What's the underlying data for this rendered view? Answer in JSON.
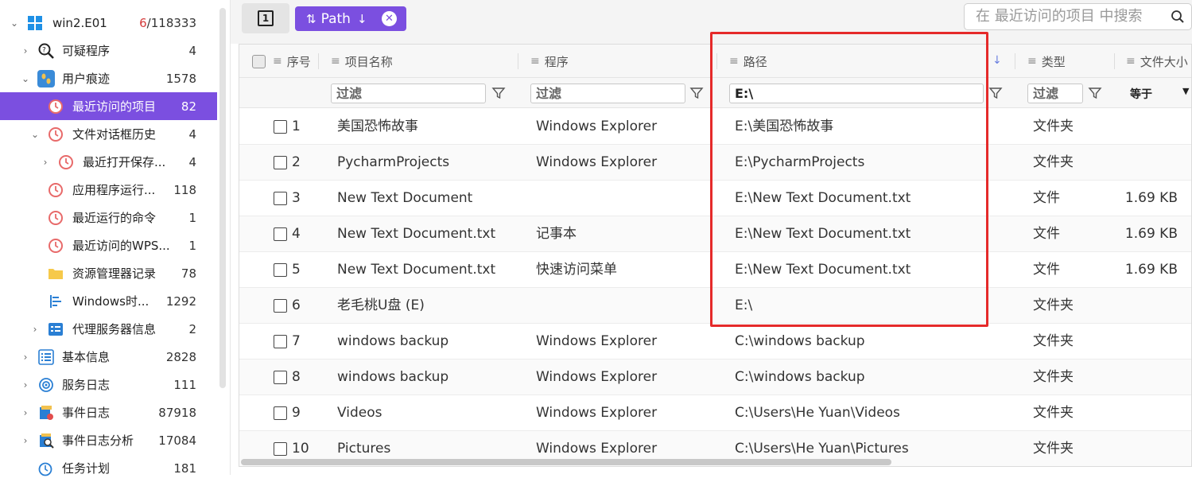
{
  "sidebar": {
    "items": [
      {
        "label": "win2.E01",
        "count_red": "6",
        "count_rest": "/118333",
        "icon": "windows-icon"
      },
      {
        "label": "可疑程序",
        "count": "4",
        "icon": "search-suspect-icon"
      },
      {
        "label": "用户痕迹",
        "count": "1578",
        "icon": "footprints-icon"
      },
      {
        "label": "最近访问的项目",
        "count": "82",
        "icon": "clock-icon"
      },
      {
        "label": "文件对话框历史",
        "count": "4",
        "icon": "clock-icon"
      },
      {
        "label": "最近打开保存...",
        "count": "4",
        "icon": "clock-icon"
      },
      {
        "label": "应用程序运行...",
        "count": "118",
        "icon": "clock-icon"
      },
      {
        "label": "最近运行的命令",
        "count": "1",
        "icon": "clock-icon"
      },
      {
        "label": "最近访问的WPS...",
        "count": "1",
        "icon": "clock-icon"
      },
      {
        "label": "资源管理器记录",
        "count": "78",
        "icon": "folder-icon"
      },
      {
        "label": "Windows时...",
        "count": "1292",
        "icon": "timeline-icon"
      },
      {
        "label": "代理服务器信息",
        "count": "2",
        "icon": "proxy-icon"
      },
      {
        "label": "基本信息",
        "count": "2828",
        "icon": "list-icon"
      },
      {
        "label": "服务日志",
        "count": "111",
        "icon": "service-icon"
      },
      {
        "label": "事件日志",
        "count": "87918",
        "icon": "event-log-icon"
      },
      {
        "label": "事件日志分析",
        "count": "17084",
        "icon": "event-analysis-icon"
      },
      {
        "label": "任务计划",
        "count": "181",
        "icon": "task-icon"
      }
    ]
  },
  "toolbar": {
    "toggle_label": "1",
    "chip_sort_glyph": "⇅",
    "chip_label": "Path",
    "chip_arrow": "↓",
    "chip_close": "✕",
    "search_placeholder": "在 最近访问的项目 中搜索"
  },
  "grid": {
    "columns": [
      "序号",
      "项目名称",
      "程序",
      "路径",
      "类型",
      "文件大小"
    ],
    "filters": {
      "name": "过滤",
      "program": "过滤",
      "path": "E:\\",
      "type": "过滤",
      "size_op": "等于"
    },
    "rows": [
      {
        "no": "1",
        "name": "美国恐怖故事",
        "program": "Windows Explorer",
        "path": "E:\\美国恐怖故事",
        "type": "文件夹",
        "size": ""
      },
      {
        "no": "2",
        "name": "PycharmProjects",
        "program": "Windows Explorer",
        "path": "E:\\PycharmProjects",
        "type": "文件夹",
        "size": ""
      },
      {
        "no": "3",
        "name": "New Text Document",
        "program": "",
        "path": "E:\\New Text Document.txt",
        "type": "文件",
        "size": "1.69 KB"
      },
      {
        "no": "4",
        "name": "New Text Document.txt",
        "program": "记事本",
        "path": "E:\\New Text Document.txt",
        "type": "文件",
        "size": "1.69 KB"
      },
      {
        "no": "5",
        "name": "New Text Document.txt",
        "program": "快速访问菜单",
        "path": "E:\\New Text Document.txt",
        "type": "文件",
        "size": "1.69 KB"
      },
      {
        "no": "6",
        "name": "老毛桃U盘 (E)",
        "program": "",
        "path": "E:\\",
        "type": "文件夹",
        "size": ""
      },
      {
        "no": "7",
        "name": "windows backup",
        "program": "Windows Explorer",
        "path": "C:\\windows backup",
        "type": "文件夹",
        "size": ""
      },
      {
        "no": "8",
        "name": "windows backup",
        "program": "Windows Explorer",
        "path": "C:\\windows backup",
        "type": "文件夹",
        "size": ""
      },
      {
        "no": "9",
        "name": "Videos",
        "program": "Windows Explorer",
        "path": "C:\\Users\\He Yuan\\Videos",
        "type": "文件夹",
        "size": ""
      },
      {
        "no": "10",
        "name": "Pictures",
        "program": "Windows Explorer",
        "path": "C:\\Users\\He Yuan\\Pictures",
        "type": "文件夹",
        "size": ""
      }
    ]
  },
  "colors": {
    "accent": "#7b4fe0",
    "highlight": "#e52a2a"
  }
}
